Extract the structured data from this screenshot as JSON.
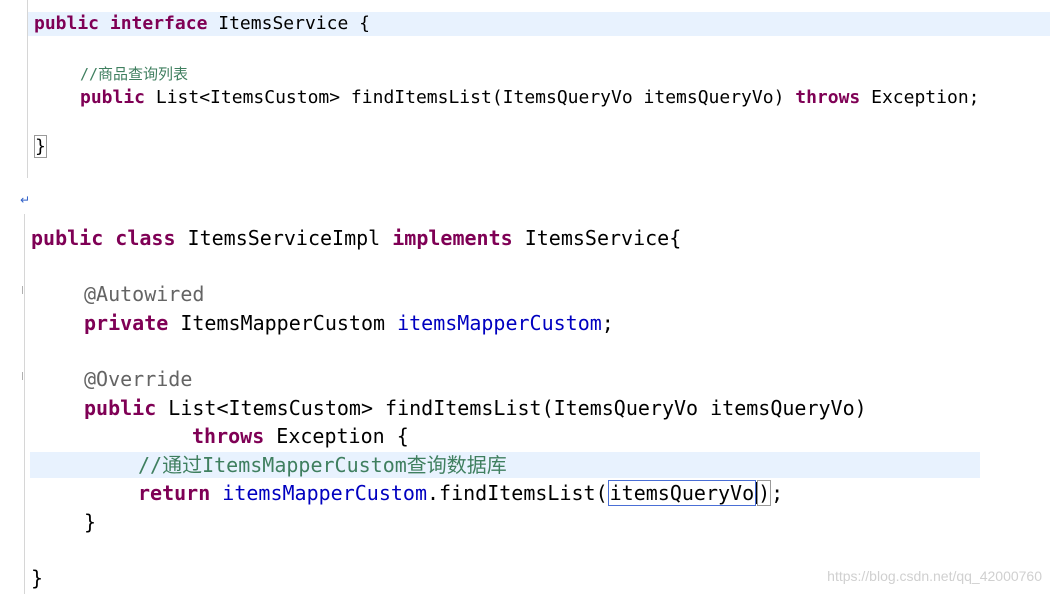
{
  "interface_panel": {
    "line1": {
      "kw1": "public",
      "kw2": "interface",
      "rest": " ItemsService {"
    },
    "comment": "//商品查询列表",
    "line3": {
      "kw1": "public",
      "mid": " List<ItemsCustom> findItemsList(ItemsQueryVo itemsQueryVo) ",
      "kw2": "throws",
      "rest": " Exception;"
    },
    "close": "}"
  },
  "return_mark": "↵",
  "impl_panel": {
    "line1": {
      "kw1": "public",
      "kw2": "class",
      "mid": " ItemsServiceImpl ",
      "kw3": "implements",
      "rest": " ItemsService{"
    },
    "annotation1": "@Autowired",
    "line3": {
      "kw": "private",
      "type": " ItemsMapperCustom ",
      "field": "itemsMapperCustom",
      "semi": ";"
    },
    "annotation2": "@Override",
    "line5": {
      "kw": "public",
      "rest": " List<ItemsCustom> findItemsList(ItemsQueryVo itemsQueryVo)"
    },
    "line6": {
      "kw": "throws",
      "rest": " Exception {"
    },
    "comment": "//通过ItemsMapperCustom查询数据库",
    "line8": {
      "kw": "return",
      "field": " itemsMapperCustom",
      "call": ".findItemsList(",
      "arg": "itemsQueryVo",
      "close_paren": ")",
      "semi": ";"
    },
    "close_method": "}",
    "close_class": "}"
  },
  "watermark": "https://blog.csdn.net/qq_42000760"
}
